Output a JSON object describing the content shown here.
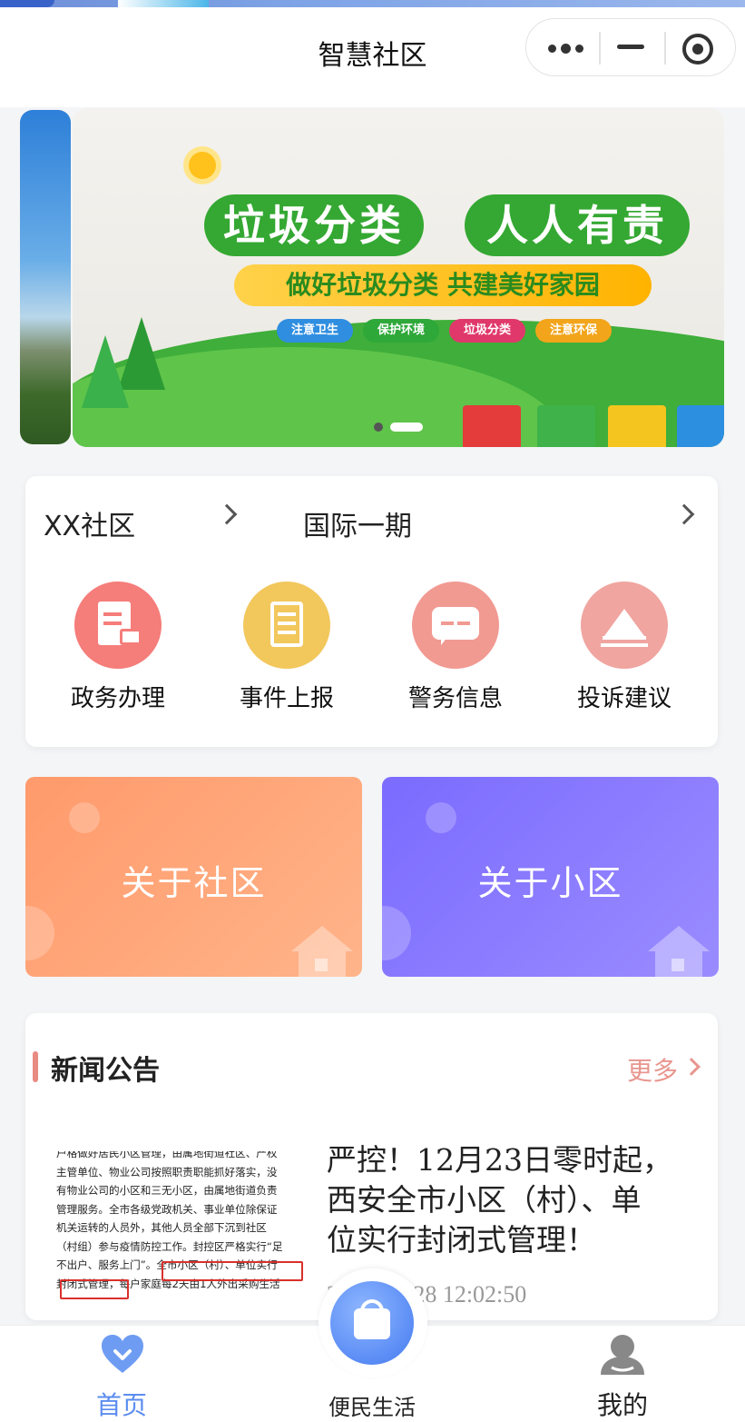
{
  "nav": {
    "title": "智慧社区"
  },
  "banner": {
    "title_left": "垃圾分类",
    "title_right": "人人有责",
    "subtitle": "做好垃圾分类 共建美好家园",
    "tags": [
      "注意卫生",
      "保护环境",
      "垃圾分类",
      "注意环保"
    ],
    "tag_colors": [
      "#2f8ee0",
      "#2fa83a",
      "#e0386a",
      "#f2a51a"
    ],
    "slides_count": 2,
    "active_slide": 2
  },
  "selector": {
    "community": "XX社区",
    "estate": "国际一期"
  },
  "services": [
    {
      "label": "政务办理",
      "icon": "document-stamp-icon",
      "color": "#f57d7a"
    },
    {
      "label": "事件上报",
      "icon": "report-doc-icon",
      "color": "#f2c75c"
    },
    {
      "label": "警务信息",
      "icon": "chat-bubble-icon",
      "color": "#f19a92"
    },
    {
      "label": "投诉建议",
      "icon": "envelope-icon",
      "color": "#f0a5a0"
    }
  ],
  "about": {
    "community_label": "关于社区",
    "estate_label": "关于小区"
  },
  "news": {
    "section_title": "新闻公告",
    "more_label": "更多",
    "item": {
      "thumbnail_lines": [
        "户格做好居民小区管理，由属地街道社区、产权",
        "主管单位、物业公司按照职责职能抓好落实，没",
        "有物业公司的小区和三无小区，由属地街道负责",
        "管理服务。全市各级党政机关、事业单位除保证",
        "机关运转的人员外，其他人员全部下沉到社区",
        "（村组）参与疫情防控工作。封控区严格实行“足",
        "不出户、服务上门”。全市小区（村）、单位实行",
        "封闭式管理，每户家庭每2天由1人外出采购生活"
      ],
      "headline": "严控！12月23日零起，西安全市小区（村）、单位实行封闭式管理！",
      "headline_line1": "严控！12月23日零时起，",
      "headline_line2": "西安全市小区（村）、单",
      "headline_line3": "位实行封闭式管理！",
      "date": "2021-12-28 12:02:50"
    }
  },
  "tabbar": {
    "home_label": "首页",
    "life_label": "便民生活",
    "me_label": "我的",
    "active_color": "#5b8def",
    "inactive_color": "#333333"
  }
}
